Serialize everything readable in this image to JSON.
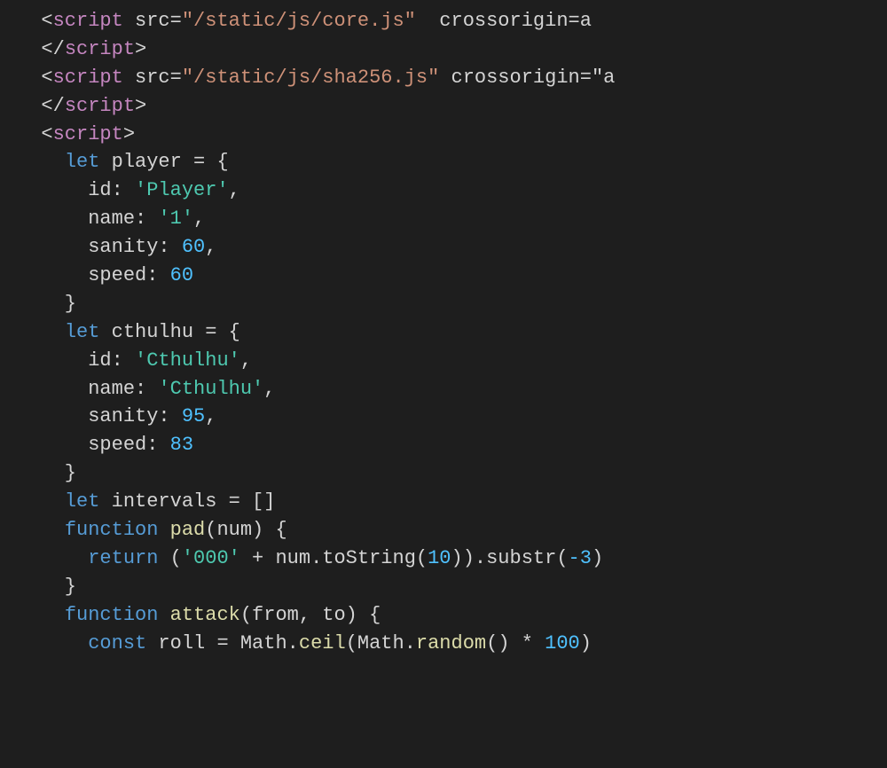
{
  "code": {
    "lines": [
      {
        "tokens": [
          {
            "text": "  <",
            "cls": "plain"
          },
          {
            "text": "script",
            "cls": "kw-purple"
          },
          {
            "text": " src=",
            "cls": "plain"
          },
          {
            "text": "\"/static/js/core.js\"",
            "cls": "attr-val"
          },
          {
            "text": "  crossorigin=",
            "cls": "plain"
          },
          {
            "text": "a",
            "cls": "plain"
          }
        ]
      },
      {
        "tokens": [
          {
            "text": "  </",
            "cls": "plain"
          },
          {
            "text": "script",
            "cls": "kw-purple"
          },
          {
            "text": ">",
            "cls": "plain"
          }
        ]
      },
      {
        "tokens": [
          {
            "text": "  <",
            "cls": "plain"
          },
          {
            "text": "script",
            "cls": "kw-purple"
          },
          {
            "text": " src=",
            "cls": "plain"
          },
          {
            "text": "\"/static/js/sha256.js\"",
            "cls": "attr-val"
          },
          {
            "text": " crossorigin=",
            "cls": "plain"
          },
          {
            "text": "\"a",
            "cls": "plain"
          }
        ]
      },
      {
        "tokens": [
          {
            "text": "  </",
            "cls": "plain"
          },
          {
            "text": "script",
            "cls": "kw-purple"
          },
          {
            "text": ">",
            "cls": "plain"
          }
        ]
      },
      {
        "tokens": [
          {
            "text": "  <",
            "cls": "plain"
          },
          {
            "text": "script",
            "cls": "kw-purple"
          },
          {
            "text": ">",
            "cls": "plain"
          }
        ]
      },
      {
        "tokens": [
          {
            "text": "    ",
            "cls": "plain"
          },
          {
            "text": "let",
            "cls": "kw-blue"
          },
          {
            "text": " player = {",
            "cls": "plain"
          }
        ]
      },
      {
        "tokens": [
          {
            "text": "      id: ",
            "cls": "plain"
          },
          {
            "text": "'Player'",
            "cls": "str"
          },
          {
            "text": ",",
            "cls": "plain"
          }
        ]
      },
      {
        "tokens": [
          {
            "text": "      name: ",
            "cls": "plain"
          },
          {
            "text": "'1'",
            "cls": "str"
          },
          {
            "text": ",",
            "cls": "plain"
          }
        ]
      },
      {
        "tokens": [
          {
            "text": "      sanity: ",
            "cls": "plain"
          },
          {
            "text": "60",
            "cls": "num"
          },
          {
            "text": ",",
            "cls": "plain"
          }
        ]
      },
      {
        "tokens": [
          {
            "text": "      speed: ",
            "cls": "plain"
          },
          {
            "text": "60",
            "cls": "num"
          }
        ]
      },
      {
        "tokens": [
          {
            "text": "    }",
            "cls": "plain"
          }
        ]
      },
      {
        "tokens": [
          {
            "text": "    ",
            "cls": "plain"
          },
          {
            "text": "let",
            "cls": "kw-blue"
          },
          {
            "text": " cthulhu = {",
            "cls": "plain"
          }
        ]
      },
      {
        "tokens": [
          {
            "text": "      id: ",
            "cls": "plain"
          },
          {
            "text": "'Cthulhu'",
            "cls": "str"
          },
          {
            "text": ",",
            "cls": "plain"
          }
        ]
      },
      {
        "tokens": [
          {
            "text": "      name: ",
            "cls": "plain"
          },
          {
            "text": "'Cthulhu'",
            "cls": "str"
          },
          {
            "text": ",",
            "cls": "plain"
          }
        ]
      },
      {
        "tokens": [
          {
            "text": "      sanity: ",
            "cls": "plain"
          },
          {
            "text": "95",
            "cls": "num"
          },
          {
            "text": ",",
            "cls": "plain"
          }
        ]
      },
      {
        "tokens": [
          {
            "text": "      speed: ",
            "cls": "plain"
          },
          {
            "text": "83",
            "cls": "num"
          }
        ]
      },
      {
        "tokens": [
          {
            "text": "    }",
            "cls": "plain"
          }
        ]
      },
      {
        "tokens": [
          {
            "text": "    ",
            "cls": "plain"
          },
          {
            "text": "let",
            "cls": "kw-blue"
          },
          {
            "text": " intervals = []",
            "cls": "plain"
          }
        ]
      },
      {
        "tokens": [
          {
            "text": "",
            "cls": "plain"
          }
        ]
      },
      {
        "tokens": [
          {
            "text": "    ",
            "cls": "plain"
          },
          {
            "text": "function",
            "cls": "kw-blue"
          },
          {
            "text": " ",
            "cls": "plain"
          },
          {
            "text": "pad",
            "cls": "fn-name"
          },
          {
            "text": "(num) {",
            "cls": "plain"
          }
        ]
      },
      {
        "tokens": [
          {
            "text": "      ",
            "cls": "plain"
          },
          {
            "text": "return",
            "cls": "kw-blue"
          },
          {
            "text": " (",
            "cls": "plain"
          },
          {
            "text": "'000'",
            "cls": "str"
          },
          {
            "text": " + num.toString(",
            "cls": "plain"
          },
          {
            "text": "10",
            "cls": "num"
          },
          {
            "text": ")).substr(",
            "cls": "plain"
          },
          {
            "text": "-3",
            "cls": "num"
          },
          {
            "text": ")",
            "cls": "plain"
          }
        ]
      },
      {
        "tokens": [
          {
            "text": "    }",
            "cls": "plain"
          }
        ]
      },
      {
        "tokens": [
          {
            "text": "",
            "cls": "plain"
          }
        ]
      },
      {
        "tokens": [
          {
            "text": "    ",
            "cls": "plain"
          },
          {
            "text": "function",
            "cls": "kw-blue"
          },
          {
            "text": " ",
            "cls": "plain"
          },
          {
            "text": "attack",
            "cls": "fn-name"
          },
          {
            "text": "(from, to) {",
            "cls": "plain"
          }
        ]
      },
      {
        "tokens": [
          {
            "text": "      ",
            "cls": "plain"
          },
          {
            "text": "const",
            "cls": "kw-blue"
          },
          {
            "text": " roll = Math.",
            "cls": "plain"
          },
          {
            "text": "ceil",
            "cls": "fn-name"
          },
          {
            "text": "(Math.",
            "cls": "plain"
          },
          {
            "text": "random",
            "cls": "fn-name"
          },
          {
            "text": "() * ",
            "cls": "plain"
          },
          {
            "text": "100",
            "cls": "num"
          },
          {
            "text": ")",
            "cls": "plain"
          }
        ]
      }
    ]
  }
}
